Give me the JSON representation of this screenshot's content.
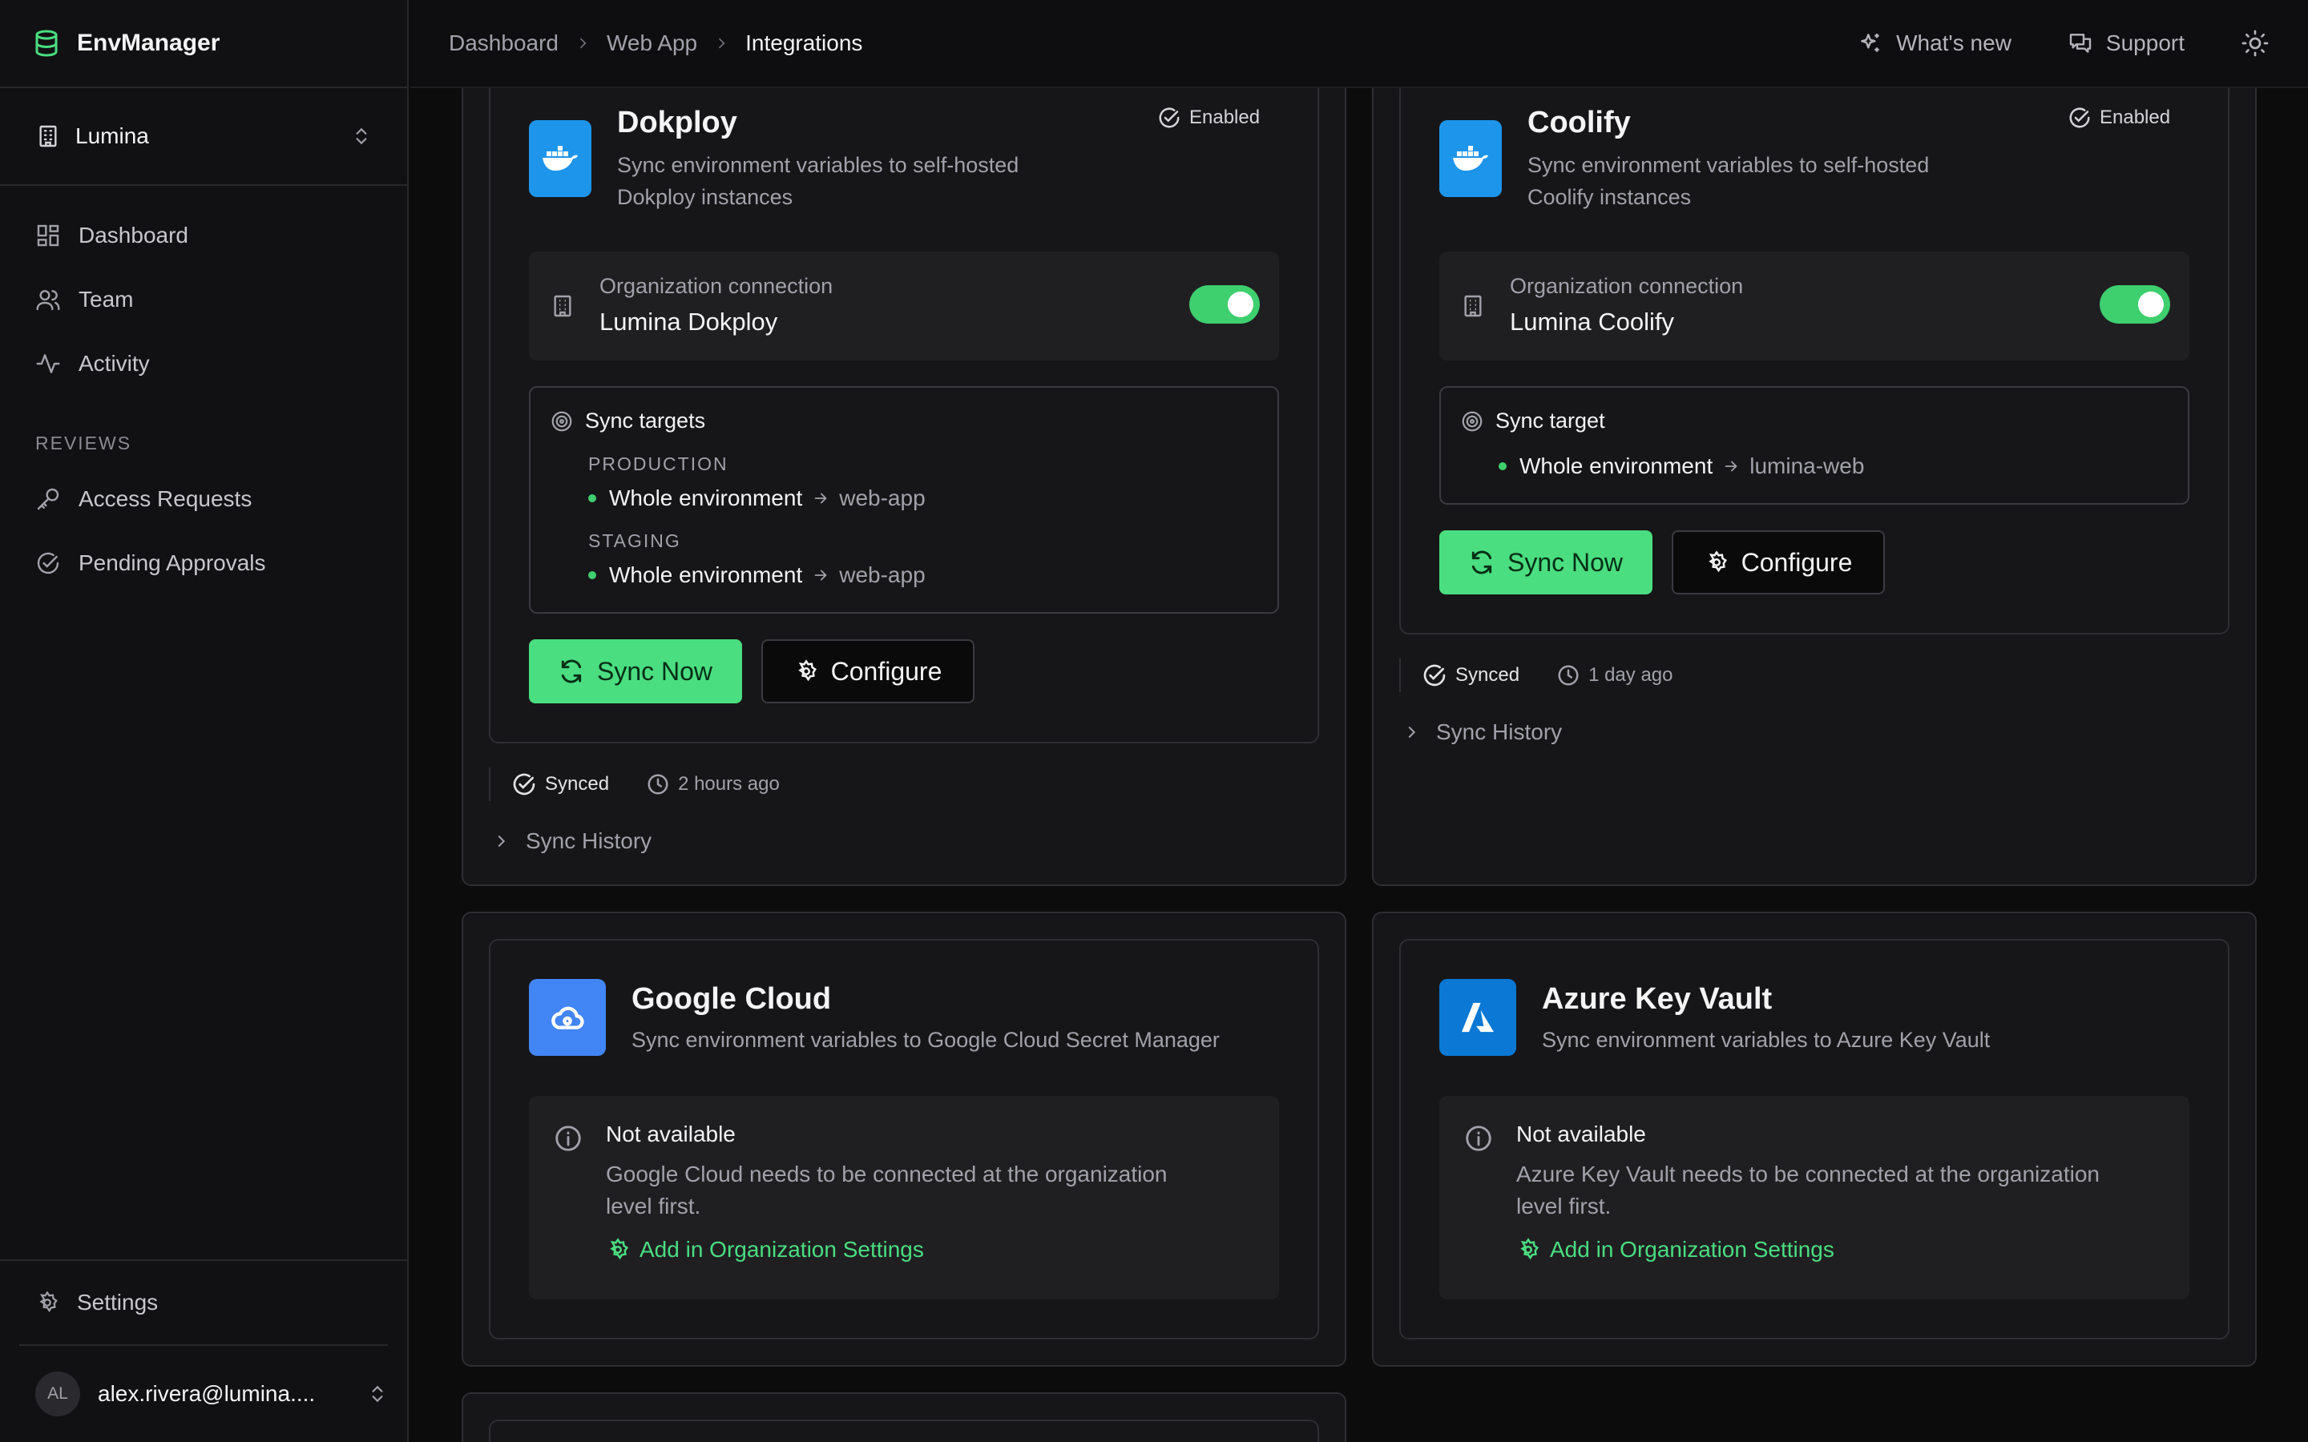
{
  "app": {
    "name": "EnvManager"
  },
  "org": {
    "name": "Lumina"
  },
  "nav": {
    "dashboard": "Dashboard",
    "team": "Team",
    "activity": "Activity",
    "reviews_section": "REVIEWS",
    "access_requests": "Access Requests",
    "pending_approvals": "Pending Approvals",
    "settings": "Settings"
  },
  "user": {
    "initials": "AL",
    "email": "alex.rivera@lumina...."
  },
  "breadcrumb": {
    "b1": "Dashboard",
    "b2": "Web App",
    "b3": "Integrations"
  },
  "topbar": {
    "whats_new": "What's new",
    "support": "Support"
  },
  "dokploy": {
    "title": "Dokploy",
    "desc1": "Sync environment variables to self-hosted",
    "desc2": "Dokploy instances",
    "enabled": "Enabled",
    "conn_label": "Organization connection",
    "conn_name": "Lumina Dokploy",
    "targets_title": "Sync targets",
    "env1": "PRODUCTION",
    "env1_source": "Whole environment",
    "env1_target": "web-app",
    "env2": "STAGING",
    "env2_source": "Whole environment",
    "env2_target": "web-app",
    "sync_now": "Sync Now",
    "configure": "Configure",
    "status": "Synced",
    "time": "2 hours ago",
    "history": "Sync History"
  },
  "coolify": {
    "title": "Coolify",
    "desc1": "Sync environment variables to self-hosted",
    "desc2": "Coolify instances",
    "enabled": "Enabled",
    "conn_label": "Organization connection",
    "conn_name": "Lumina Coolify",
    "targets_title": "Sync target",
    "env1_source": "Whole environment",
    "env1_target": "lumina-web",
    "sync_now": "Sync Now",
    "configure": "Configure",
    "status": "Synced",
    "time": "1 day ago",
    "history": "Sync History"
  },
  "gcloud": {
    "title": "Google Cloud",
    "desc": "Sync environment variables to Google Cloud Secret Manager",
    "na_title": "Not available",
    "na_text1": "Google Cloud needs to be connected at the organization",
    "na_text2": "level first.",
    "na_link": "Add in Organization Settings"
  },
  "azure": {
    "title": "Azure Key Vault",
    "desc": "Sync environment variables to Azure Key Vault",
    "na_title": "Not available",
    "na_text1": "Azure Key Vault needs to be connected at the organization",
    "na_text2": "level first.",
    "na_link": "Add in Organization Settings"
  },
  "colors": {
    "accent": "#4ade80",
    "docker_blue": "#1d95ea",
    "gcloud_blue": "#4285f4",
    "azure_blue": "#0a78d4"
  }
}
